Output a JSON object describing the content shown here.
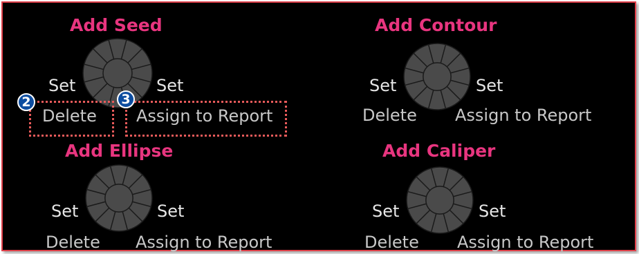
{
  "panels": {
    "seed": {
      "title": "Add Seed",
      "set_left": "Set",
      "set_right": "Set",
      "delete": "Delete",
      "assign": "Assign to Report"
    },
    "contour": {
      "title": "Add Contour",
      "set_left": "Set",
      "set_right": "Set",
      "delete": "Delete",
      "assign": "Assign to Report"
    },
    "ellipse": {
      "title": "Add Ellipse",
      "set_left": "Set",
      "set_right": "Set",
      "delete": "Delete",
      "assign": "Assign to Report"
    },
    "caliper": {
      "title": "Add Caliper",
      "set_left": "Set",
      "set_right": "Set",
      "delete": "Delete",
      "assign": "Assign to Report"
    }
  },
  "callouts": {
    "delete_badge": "2",
    "assign_badge": "3"
  },
  "colors": {
    "title": "#e8357f",
    "label": "#e6e6e6",
    "knob": "#4a4a4a",
    "callout": "#e85a5a",
    "badge": "#0d4da0"
  }
}
